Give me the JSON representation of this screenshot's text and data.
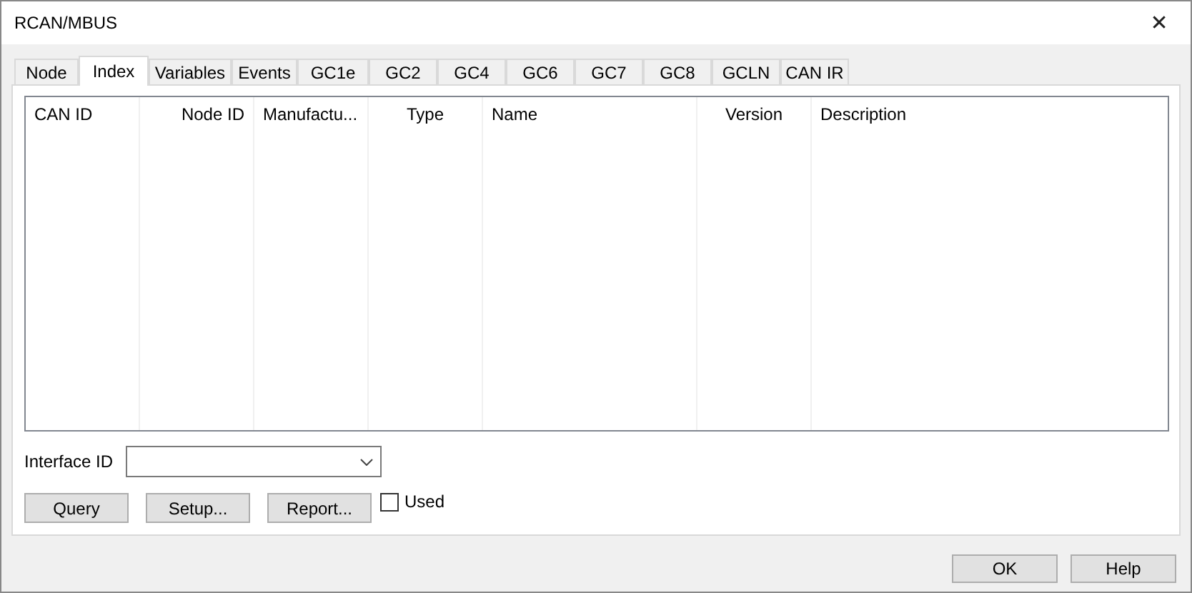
{
  "window": {
    "title": "RCAN/MBUS",
    "close": "✕"
  },
  "tabs": [
    {
      "label": "Node",
      "selected": false
    },
    {
      "label": "Index",
      "selected": true
    },
    {
      "label": "Variables",
      "selected": false
    },
    {
      "label": "Events",
      "selected": false
    },
    {
      "label": "GC1e",
      "selected": false
    },
    {
      "label": "GC2",
      "selected": false
    },
    {
      "label": "GC4",
      "selected": false
    },
    {
      "label": "GC6",
      "selected": false
    },
    {
      "label": "GC7",
      "selected": false
    },
    {
      "label": "GC8",
      "selected": false
    },
    {
      "label": "GCLN",
      "selected": false
    },
    {
      "label": "CAN IR",
      "selected": false
    }
  ],
  "table": {
    "columns": [
      "CAN ID",
      "Node ID",
      "Manufactu...",
      "Type",
      "Name",
      "Version",
      "Description"
    ]
  },
  "interface": {
    "label": "Interface ID"
  },
  "buttons": [
    "Query",
    "Setup...",
    "Report..."
  ],
  "used": {
    "label": "Used",
    "checked": false
  },
  "footer_buttons": [
    "OK",
    "Help"
  ]
}
